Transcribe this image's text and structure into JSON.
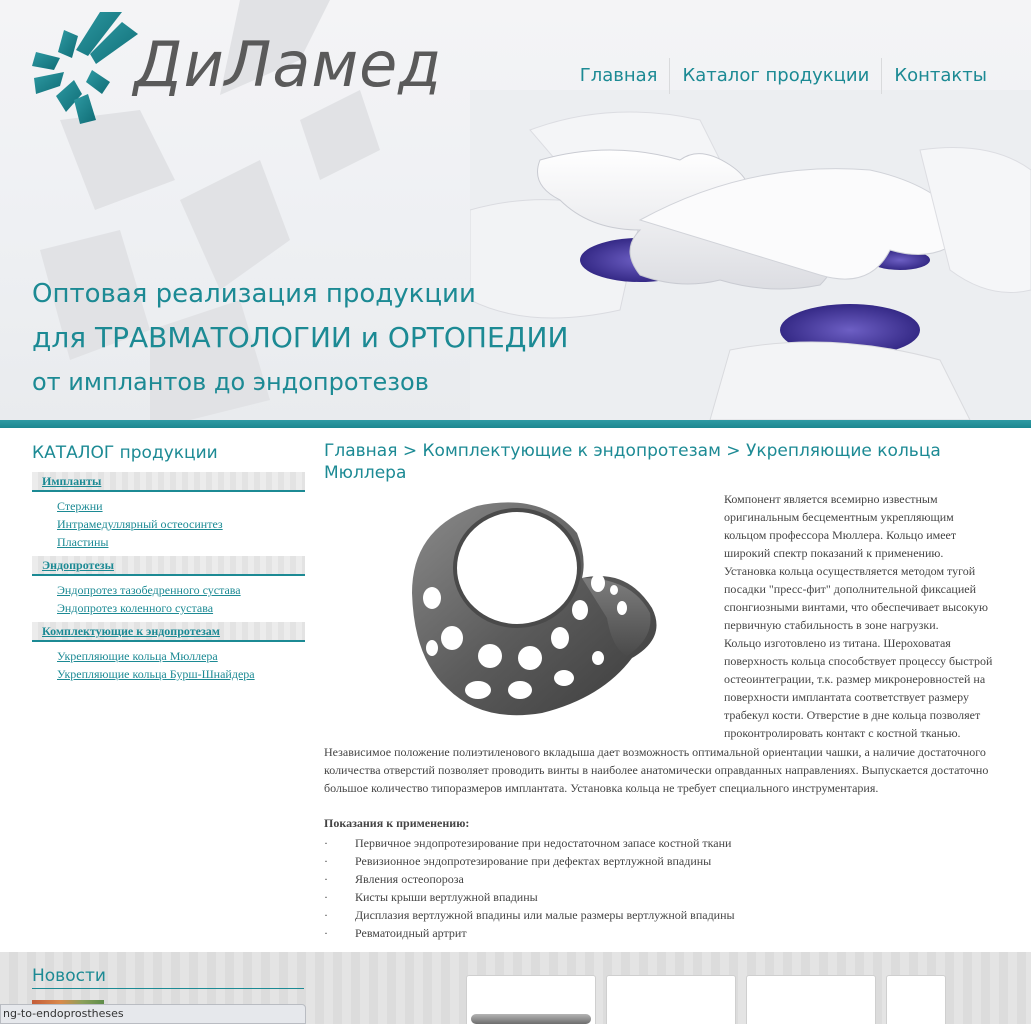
{
  "brand": {
    "name": "ДиЛамед"
  },
  "nav": {
    "items": [
      "Главная",
      "Каталог продукции",
      "Контакты"
    ]
  },
  "hero": {
    "line1": "Оптовая реализация продукции",
    "line2": "для ТРАВМАТОЛОГИИ и ОРТОПЕДИИ",
    "line3": "от имплантов до эндопротезов"
  },
  "sidebar": {
    "title": "КАТАЛОГ продукции",
    "categories": [
      {
        "name": "Импланты",
        "items": [
          "Стержни",
          "Интрамедуллярный остеосинтез",
          "Пластины"
        ]
      },
      {
        "name": "Эндопротезы",
        "items": [
          "Эндопротез тазобедренного сустава",
          "Эндопротез коленного сустава"
        ]
      },
      {
        "name": "Комплектующие к эндопротезам",
        "items": [
          "Укрепляющие кольца Мюллера",
          "Укрепляющие кольца Бурш-Шнайдера"
        ]
      }
    ]
  },
  "main": {
    "breadcrumb": "Главная > Комплектующие к эндопротезам > Укрепляющие кольца Мюллера",
    "paragraph1": "Компонент является всемирно известным оригинальным бесцементным укрепляющим кольцом профессора  Мюллера. Кольцо имеет широкий спектр показаний к применению. Установка кольца осуществляется методом тугой посадки \"пресс-фит\" дополнительной фиксацией спонгиозными винтами, что обеспечивает высокую первичную стабильность в зоне нагрузки.",
    "paragraph2": "Кольцо изготовлено из титана.  Шероховатая поверхность кольца способствует процессу быстрой остеоинтеграции, т.к. размер микронеровностей на поверхности имплантата соответствует размеру трабекул кости. Отверстие в дне кольца позволяет проконтролировать контакт с костной тканью.",
    "paragraph3": "Независимое положение полиэтиленового вкладыша дает возможность оптимальной ориентации чашки, а наличие достаточного количества отверстий позволяет проводить винты в наиболее анатомически оправданных направлениях. Выпускается достаточно большое количество типоразмеров имплантата. Установка кольца не требует специального инструментария.",
    "indications_title": "Показания к применению:",
    "bullet": "·",
    "indications": [
      "Первичное эндопротезирование при недостаточном запасе костной ткани",
      "Ревизионное эндопротезирование при дефектах вертлужной впадины",
      "Явления остеопороза",
      "Кисты крыши вертлужной впадины",
      "Дисплазия вертлужной впадины или малые размеры вертлужной впадины",
      "Ревматоидный артрит"
    ]
  },
  "news": {
    "title": "Новости"
  },
  "status": {
    "url": "ng-to-endoprostheses"
  },
  "colors": {
    "accent": "#1c8a94",
    "strip": "#1b8790",
    "text": "#444444"
  }
}
